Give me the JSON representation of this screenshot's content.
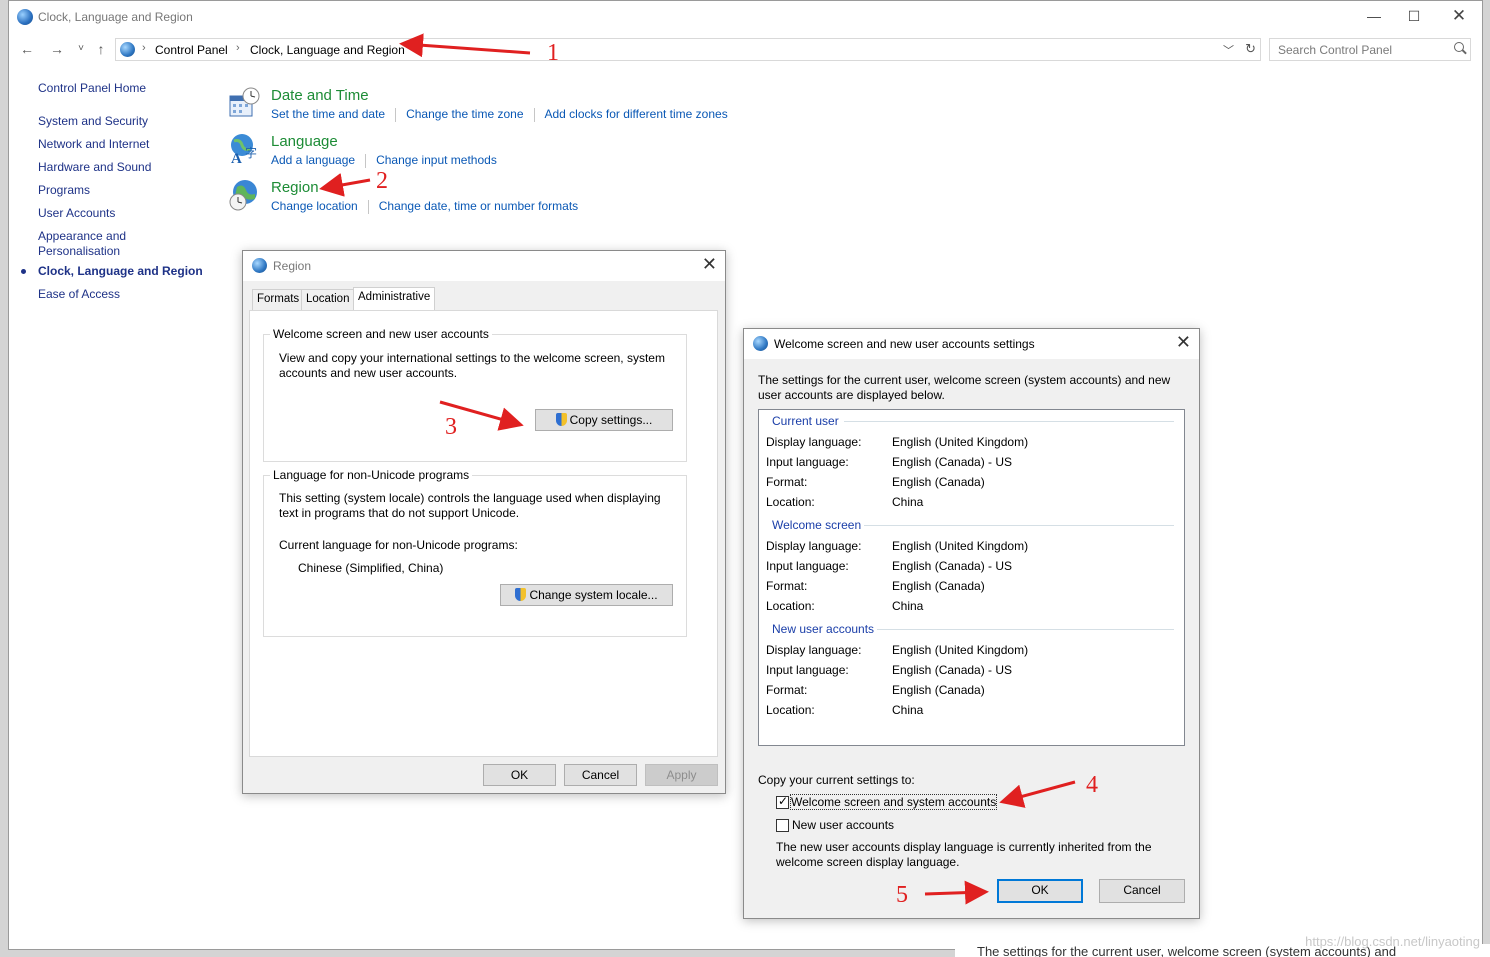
{
  "window": {
    "title": "Clock, Language and Region"
  },
  "address": {
    "crumbs": [
      "Control Panel",
      "Clock, Language and Region"
    ],
    "search_placeholder": "Search Control Panel"
  },
  "sidebar": {
    "home": "Control Panel Home",
    "items": [
      "System and Security",
      "Network and Internet",
      "Hardware and Sound",
      "Programs",
      "User Accounts",
      "Appearance and Personalisation",
      "Clock, Language and Region",
      "Ease of Access"
    ]
  },
  "categories": [
    {
      "title": "Date and Time",
      "links": [
        "Set the time and date",
        "Change the time zone",
        "Add clocks for different time zones"
      ]
    },
    {
      "title": "Language",
      "links": [
        "Add a language",
        "Change input methods"
      ]
    },
    {
      "title": "Region",
      "links": [
        "Change location",
        "Change date, time or number formats"
      ]
    }
  ],
  "region_dialog": {
    "title": "Region",
    "tabs": [
      "Formats",
      "Location",
      "Administrative"
    ],
    "welcome_group": {
      "label": "Welcome screen and new user accounts",
      "text1": "View and copy your international settings to the welcome screen, system",
      "text2": "accounts and new user accounts.",
      "button": "Copy settings..."
    },
    "unicode_group": {
      "label": "Language for non-Unicode programs",
      "text1": "This setting (system locale) controls the language used when displaying",
      "text2": "text in programs that do not support Unicode.",
      "current_label": "Current language for non-Unicode programs:",
      "current_value": "Chinese (Simplified, China)",
      "button": "Change system locale..."
    },
    "buttons": {
      "ok": "OK",
      "cancel": "Cancel",
      "apply": "Apply"
    }
  },
  "welcome_dialog": {
    "title": "Welcome screen and new user accounts settings",
    "intro1": "The settings for the current user, welcome screen (system accounts) and new",
    "intro2": "user accounts are displayed below.",
    "sections": [
      {
        "name": "Current user",
        "display": "English (United Kingdom)",
        "input": "English (Canada) - US",
        "format": "English (Canada)",
        "location": "China"
      },
      {
        "name": "Welcome screen",
        "display": "English (United Kingdom)",
        "input": "English (Canada) - US",
        "format": "English (Canada)",
        "location": "China"
      },
      {
        "name": "New user accounts",
        "display": "English (United Kingdom)",
        "input": "English (Canada) - US",
        "format": "English (Canada)",
        "location": "China"
      }
    ],
    "labels": {
      "display": "Display language:",
      "input": "Input language:",
      "format": "Format:",
      "location": "Location:"
    },
    "copy_label": "Copy your current settings to:",
    "cb_welcome": "Welcome screen and system accounts",
    "cb_new": "New user accounts",
    "note1": "The new user accounts display language is currently inherited from the",
    "note2": "welcome screen display language.",
    "ok": "OK",
    "cancel": "Cancel",
    "cb_welcome_checked": true,
    "cb_new_checked": false
  },
  "annotations": [
    "1",
    "2",
    "3",
    "4",
    "5"
  ],
  "watermark": "https://blog.csdn.net/linyaoting",
  "bottom_text": "The settings for the current user, welcome screen (system accounts) and",
  "colors": {
    "link": "#0a58b5",
    "heading": "#1d8c36",
    "annotation": "#e02020"
  }
}
